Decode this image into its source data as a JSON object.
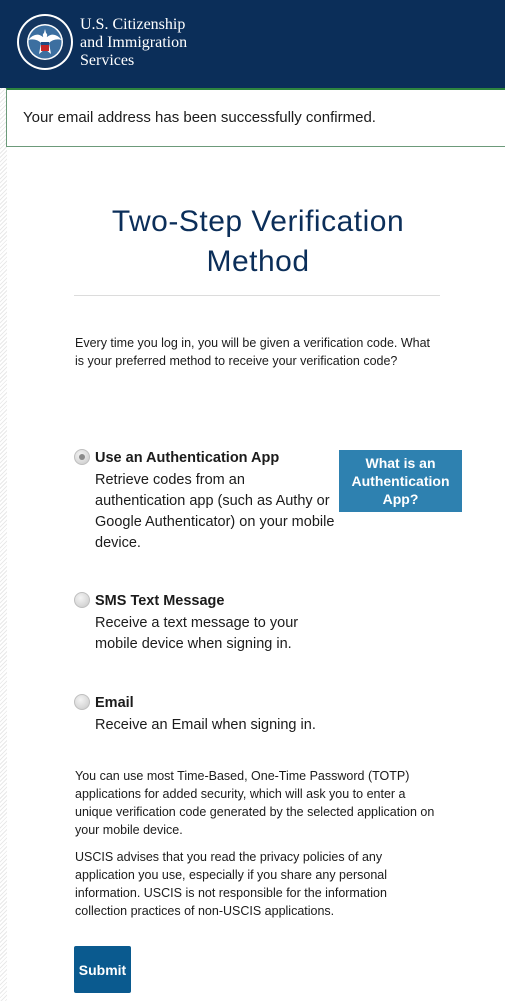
{
  "header": {
    "agency_line1": "U.S. Citizenship",
    "agency_line2": "and Immigration",
    "agency_line3": "Services",
    "seal_icon": "dhs-seal-icon"
  },
  "banner": {
    "message": "Your email address has been successfully confirmed."
  },
  "page": {
    "title": "Two-Step Verification Method",
    "intro": "Every time you log in, you will be given a verification code. What is your preferred method to receive your verification code?"
  },
  "options": [
    {
      "label": "Use an Authentication App",
      "description": "Retrieve codes from an authentication app (such as Authy or Google Authenticator) on your mobile device.",
      "selected": true
    },
    {
      "label": "SMS Text Message",
      "description": "Receive a text message to your mobile device when signing in.",
      "selected": false
    },
    {
      "label": "Email",
      "description": "Receive an Email when signing in.",
      "selected": false
    }
  ],
  "help_button": {
    "label": "What is an Authentication App?"
  },
  "notes": {
    "totp": "You can use most Time-Based, One-Time Password (TOTP) applications for added security, which will ask you to enter a unique verification code generated by the selected application on your mobile device.",
    "privacy": "USCIS advises that you read the privacy policies of any application you use, especially if you share any personal information. USCIS is not responsible for the information collection practices of non-USCIS applications."
  },
  "submit": {
    "label": "Submit"
  },
  "colors": {
    "header_bg": "#0b2e59",
    "success_border": "#2e8540",
    "help_button_bg": "#2e81b0",
    "submit_bg": "#0a5a8f"
  }
}
